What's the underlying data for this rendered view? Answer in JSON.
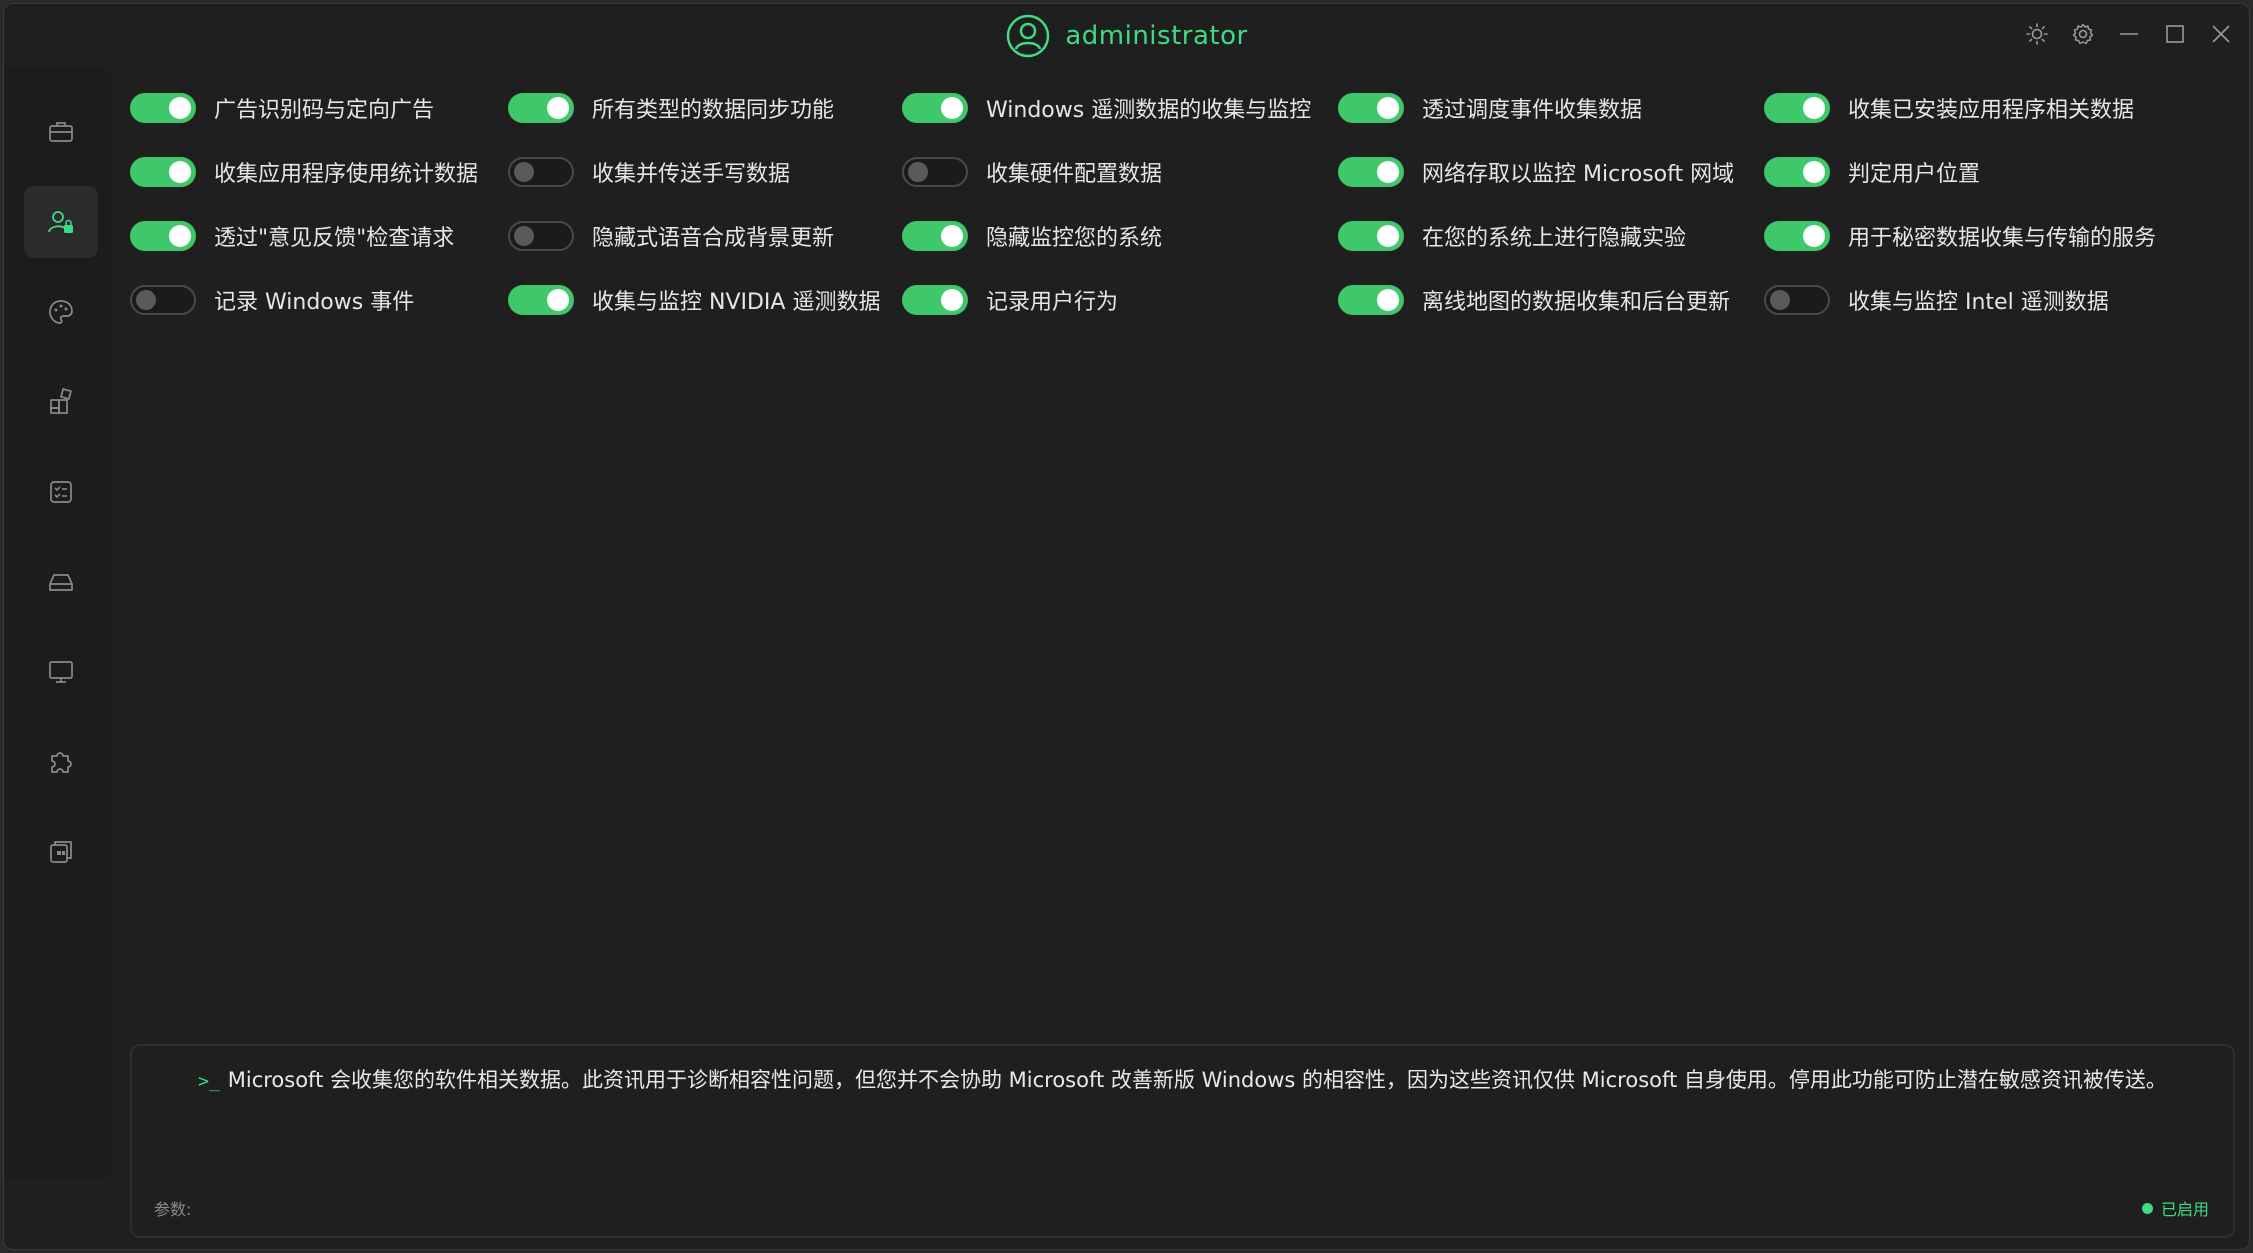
{
  "window": {
    "title": "administrator",
    "accent": "#3ddc84"
  },
  "title_controls": [
    {
      "name": "theme-brightness-icon"
    },
    {
      "name": "settings-gear-icon"
    },
    {
      "name": "minimize-icon"
    },
    {
      "name": "maximize-icon"
    },
    {
      "name": "close-icon"
    }
  ],
  "sidebar": {
    "items": [
      {
        "icon": "toolbox-icon",
        "active": false
      },
      {
        "icon": "user-privacy-icon",
        "active": true
      },
      {
        "icon": "palette-icon",
        "active": false
      },
      {
        "icon": "apps-icon",
        "active": false
      },
      {
        "icon": "tasks-icon",
        "active": false
      },
      {
        "icon": "drive-icon",
        "active": false
      },
      {
        "icon": "monitor-icon",
        "active": false
      },
      {
        "icon": "puzzle-icon",
        "active": false
      },
      {
        "icon": "windows-copy-icon",
        "active": false
      }
    ]
  },
  "toggles": [
    [
      {
        "label": "广告识别码与定向广告",
        "on": true
      },
      {
        "label": "所有类型的数据同步功能",
        "on": true
      },
      {
        "label": "Windows 遥测数据的收集与监控",
        "on": true
      },
      {
        "label": "透过调度事件收集数据",
        "on": true
      },
      {
        "label": "收集已安装应用程序相关数据",
        "on": true
      }
    ],
    [
      {
        "label": "收集应用程序使用统计数据",
        "on": true
      },
      {
        "label": "收集并传送手写数据",
        "on": false
      },
      {
        "label": "收集硬件配置数据",
        "on": false
      },
      {
        "label": "网络存取以监控 Microsoft 网域",
        "on": true
      },
      {
        "label": "判定用户位置",
        "on": true
      }
    ],
    [
      {
        "label": "透过\"意见反馈\"检查请求",
        "on": true
      },
      {
        "label": "隐藏式语音合成背景更新",
        "on": false
      },
      {
        "label": "隐藏监控您的系统",
        "on": true
      },
      {
        "label": "在您的系统上进行隐藏实验",
        "on": true
      },
      {
        "label": "用于秘密数据收集与传输的服务",
        "on": true
      }
    ],
    [
      {
        "label": "记录 Windows 事件",
        "on": false
      },
      {
        "label": "收集与监控 NVIDIA 遥测数据",
        "on": true
      },
      {
        "label": "记录用户行为",
        "on": true
      },
      {
        "label": "离线地图的数据收集和后台更新",
        "on": true
      },
      {
        "label": "收集与监控 Intel 遥测数据",
        "on": false
      }
    ]
  ],
  "console": {
    "prompt": ">_",
    "message": "Microsoft 会收集您的软件相关数据。此资讯用于诊断相容性问题，但您并不会协助 Microsoft 改善新版 Windows 的相容性，因为这些资讯仅供 Microsoft 自身使用。停用此功能可防止潜在敏感资讯被传送。",
    "param_label": "参数:",
    "status_label": "已启用",
    "status_color": "#3ddc84"
  }
}
